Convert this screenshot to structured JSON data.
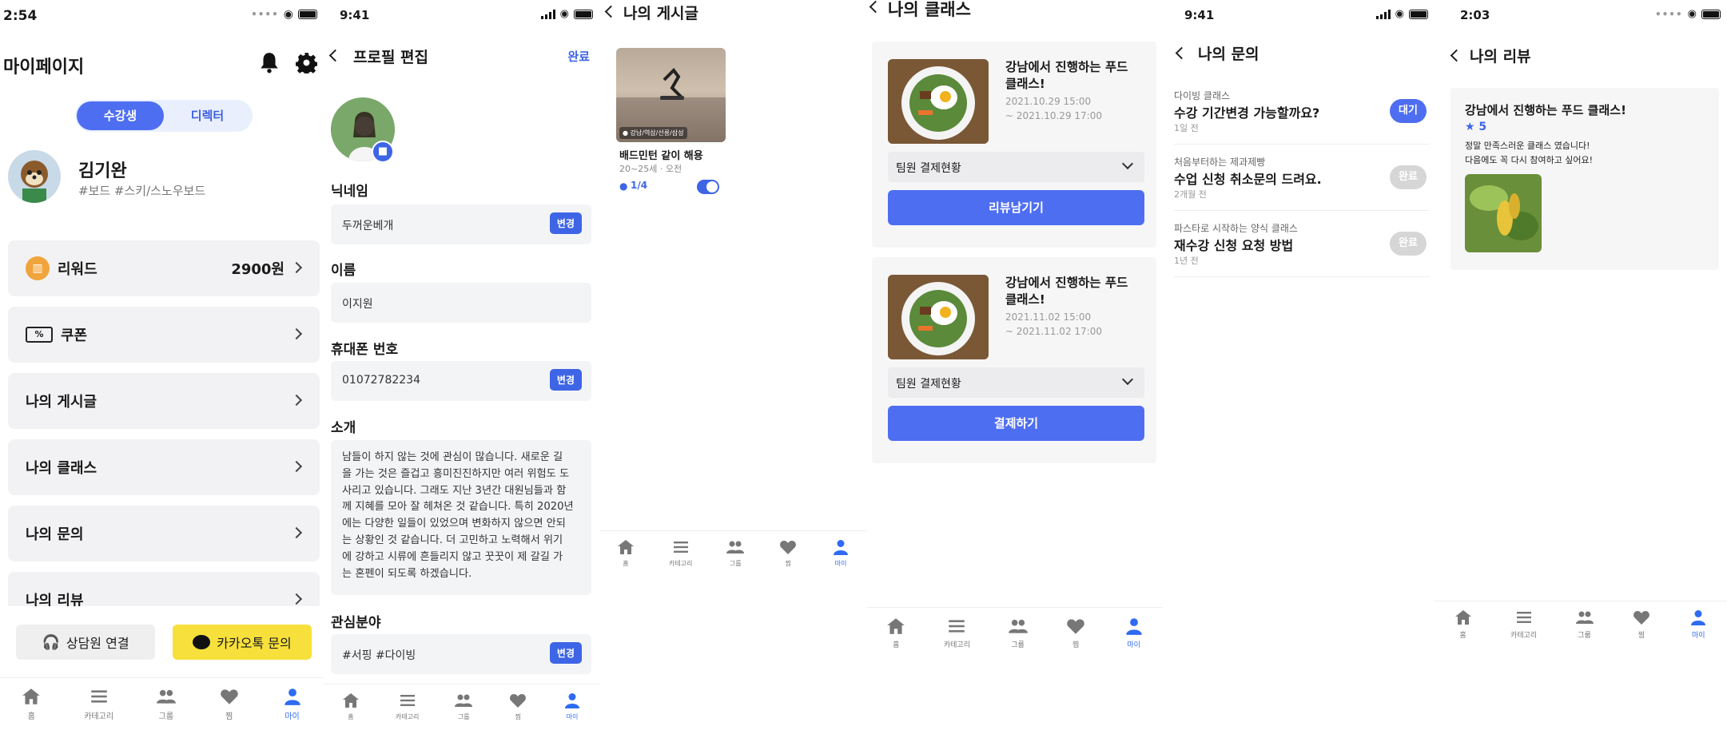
{
  "s1": {
    "time": "2:54",
    "title": "마이페이지",
    "toggle": [
      "수강생",
      "디렉터"
    ],
    "user_name": "김기완",
    "user_tags": "#보드 #스키/스노우보드",
    "reward_label": "리워드",
    "reward_value": "2900원",
    "menu": [
      "쿠폰",
      "나의 게시글",
      "나의 클래스",
      "나의 문의",
      "나의 리뷰"
    ],
    "counsel": "상담원 연결",
    "kakao": "카카오톡 문의"
  },
  "s2": {
    "time": "9:41",
    "title": "프로필 편집",
    "done": "완료",
    "nick_label": "닉네임",
    "nick_value": "두꺼운베개",
    "change": "변경",
    "name_label": "이름",
    "name_value": "이지원",
    "phone_label": "휴대폰 번호",
    "phone_value": "01072782234",
    "intro_label": "소개",
    "intro_lines": [
      "남들이 하지 않는 것에 관심이 많습니다. 새로운 길",
      "을 가는 것은 즐겁고 흥미진진하지만 여러 위험도 도",
      "사리고 있습니다. 그래도 지난 3년간 대원님들과 함",
      "께 지혜를 모아 잘 헤쳐온 것 같습니다. 특히 2020년",
      "에는 다양한 일들이 있었으며 변화하지 않으면 안되",
      "는 상황인 것 같습니다. 더 고민하고 노력해서 위기",
      "에 강하고 시류에 흔들리지 않고 꿋꿋이 제 갈길 가",
      "는 혼펜이 되도록 하겠습니다."
    ],
    "interest_label": "관심분야",
    "interest_value": "#서핑 #다이빙"
  },
  "s3": {
    "title": "나의 게시글",
    "post_location": "강남/역삼/선릉/삼성",
    "post_title": "배드민턴 같이 해용",
    "post_meta": "20~25세 · 오전",
    "post_count": "1/4"
  },
  "s4": {
    "title": "나의 클래스",
    "cards": [
      {
        "title": "강남에서 진행하는 푸드 클래스!",
        "date1": "2021.10.29 15:00",
        "date2": "~ 2021.10.29 17:00",
        "dropdown": "팀원 결제현황",
        "button": "리뷰남기기"
      },
      {
        "title": "강남에서 진행하는 푸드 클래스!",
        "date1": "2021.11.02 15:00",
        "date2": "~ 2021.11.02 17:00",
        "dropdown": "팀원 결제현황",
        "button": "결제하기"
      }
    ]
  },
  "s5": {
    "time": "9:41",
    "title": "나의 문의",
    "items": [
      {
        "cat": "다이빙 클래스",
        "q": "수강 기간변경 가능할까요?",
        "ago": "1일 전",
        "status": "대기",
        "pending": true
      },
      {
        "cat": "처음부터하는 제과제빵",
        "q": "수업 신청 취소문의 드려요.",
        "ago": "2개월 전",
        "status": "완료",
        "pending": false
      },
      {
        "cat": "파스타로 시작하는 양식 클래스",
        "q": "재수강 신청 요청 방법",
        "ago": "1년 전",
        "status": "완료",
        "pending": false
      }
    ]
  },
  "s6": {
    "time": "2:03",
    "title": "나의 리뷰",
    "review_title": "강남에서 진행하는 푸드 클래스!",
    "rating": "★ 5",
    "review_line1": "정말 만족스러운 클래스 였습니다!",
    "review_line2": "다음에도 꼭 다시 참여하고 싶어요!"
  },
  "tabs": [
    "홈",
    "카테고리",
    "그룹",
    "찜",
    "마이"
  ],
  "colors": {
    "primary": "#4e6ef2",
    "kakao": "#f7e03b",
    "pending": "#4e6ef2",
    "done": "#d6d6d6"
  }
}
